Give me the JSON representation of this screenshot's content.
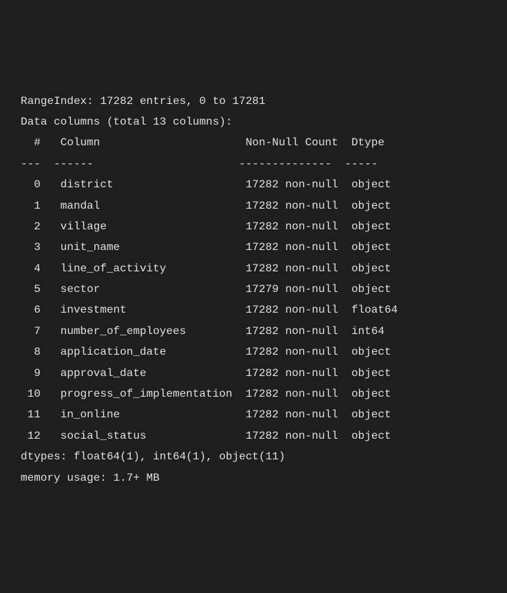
{
  "range_index_line": "RangeIndex: 17282 entries, 0 to 17281",
  "data_columns_line": "Data columns (total 13 columns):",
  "header": {
    "num": " #",
    "column": "Column",
    "nonnull": "Non-Null Count",
    "dtype": "Dtype"
  },
  "divider": {
    "num": "---",
    "column": "------",
    "nonnull": "--------------",
    "dtype": "-----"
  },
  "rows": [
    {
      "num": " 0",
      "column": "district",
      "nonnull": "17282 non-null",
      "dtype": "object"
    },
    {
      "num": " 1",
      "column": "mandal",
      "nonnull": "17282 non-null",
      "dtype": "object"
    },
    {
      "num": " 2",
      "column": "village",
      "nonnull": "17282 non-null",
      "dtype": "object"
    },
    {
      "num": " 3",
      "column": "unit_name",
      "nonnull": "17282 non-null",
      "dtype": "object"
    },
    {
      "num": " 4",
      "column": "line_of_activity",
      "nonnull": "17282 non-null",
      "dtype": "object"
    },
    {
      "num": " 5",
      "column": "sector",
      "nonnull": "17279 non-null",
      "dtype": "object"
    },
    {
      "num": " 6",
      "column": "investment",
      "nonnull": "17282 non-null",
      "dtype": "float64"
    },
    {
      "num": " 7",
      "column": "number_of_employees",
      "nonnull": "17282 non-null",
      "dtype": "int64"
    },
    {
      "num": " 8",
      "column": "application_date",
      "nonnull": "17282 non-null",
      "dtype": "object"
    },
    {
      "num": " 9",
      "column": "approval_date",
      "nonnull": "17282 non-null",
      "dtype": "object"
    },
    {
      "num": "10",
      "column": "progress_of_implementation",
      "nonnull": "17282 non-null",
      "dtype": "object"
    },
    {
      "num": "11",
      "column": "in_online",
      "nonnull": "17282 non-null",
      "dtype": "object"
    },
    {
      "num": "12",
      "column": "social_status",
      "nonnull": "17282 non-null",
      "dtype": "object"
    }
  ],
  "dtypes_line": "dtypes: float64(1), int64(1), object(11)",
  "memory_line": "memory usage: 1.7+ MB"
}
